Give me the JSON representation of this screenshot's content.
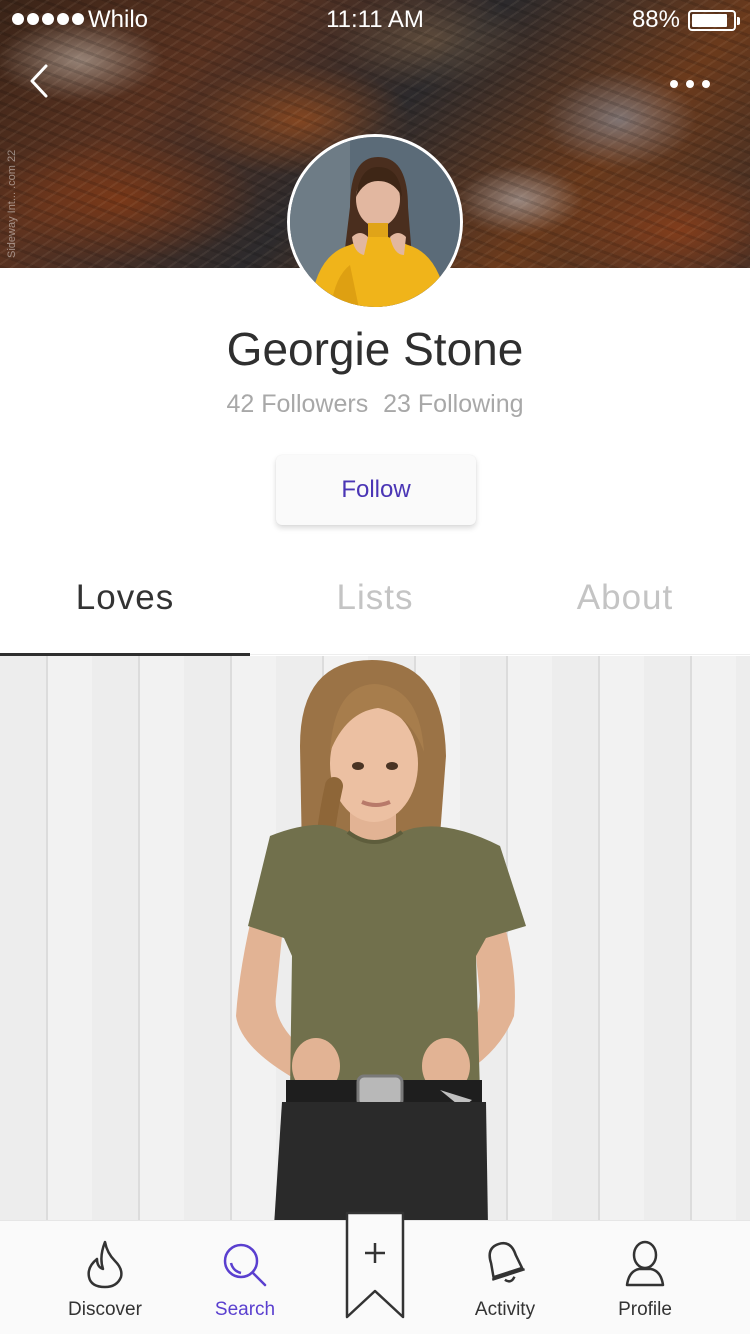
{
  "status_bar": {
    "carrier": "Whilo",
    "time": "11:11 AM",
    "battery_percent": "88%",
    "battery_level": 0.88
  },
  "header": {
    "back_icon": "chevron-left-icon",
    "more_icon": "more-dots-icon",
    "watermark": "Sideway Int... .com 22"
  },
  "profile": {
    "name": "Georgie Stone",
    "followers": "42 Followers",
    "following": "23 Following",
    "follow_label": "Follow"
  },
  "tabs": [
    {
      "label": "Loves",
      "active": true
    },
    {
      "label": "Lists",
      "active": false
    },
    {
      "label": "About",
      "active": false
    }
  ],
  "bottom_nav": {
    "items": [
      {
        "label": "Discover",
        "icon": "flame-icon",
        "active": false
      },
      {
        "label": "Search",
        "icon": "search-icon",
        "active": true
      },
      {
        "label": "Activity",
        "icon": "bell-icon",
        "active": false
      },
      {
        "label": "Profile",
        "icon": "person-icon",
        "active": false
      }
    ],
    "add_icon": "plus-icon"
  },
  "colors": {
    "accent": "#5a3fcf",
    "follow_text": "#4a35b5",
    "text_dark": "#2f2f2f",
    "text_muted": "#a8a8a8"
  }
}
